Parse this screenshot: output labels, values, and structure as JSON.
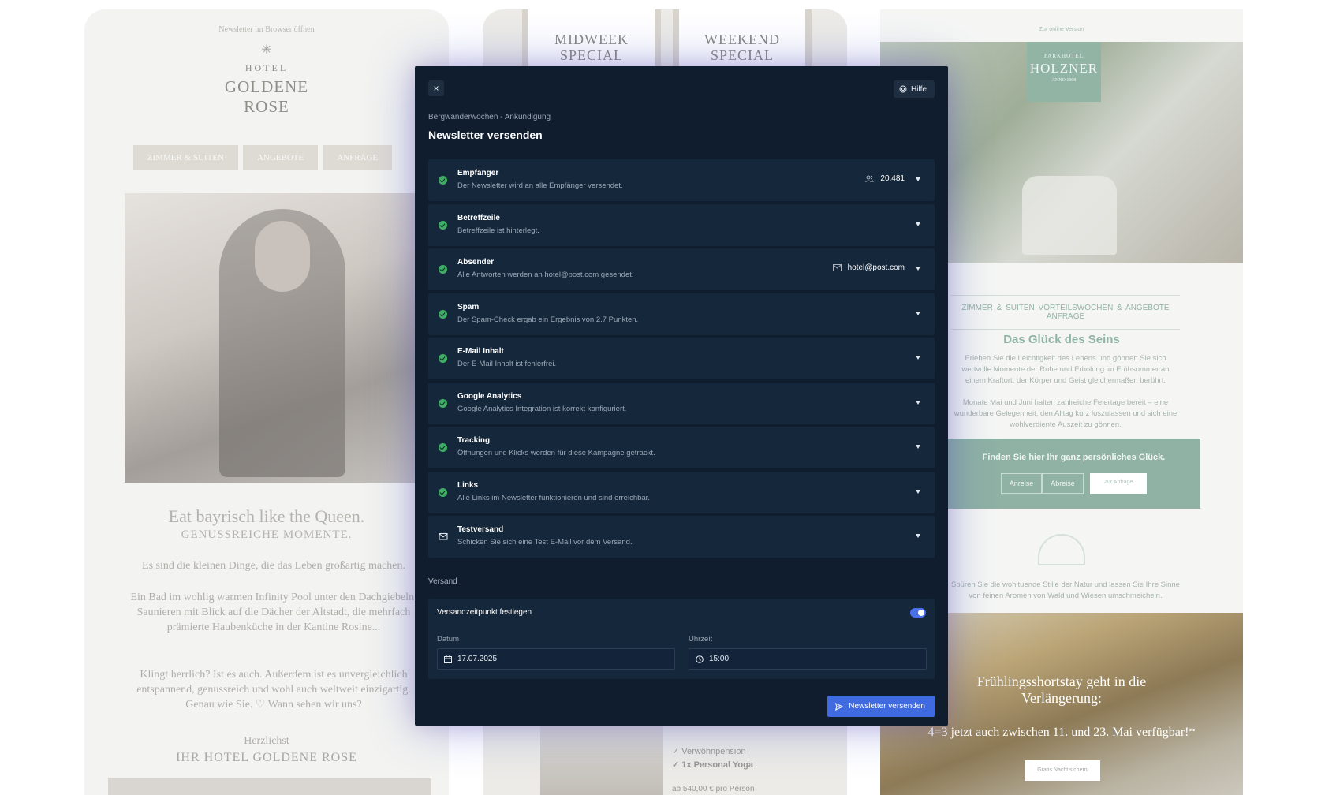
{
  "background": {
    "left": {
      "topline": "Newsletter im Browser öffnen",
      "hotel_word": "HOTEL",
      "hotel_name": "GOLDENE ROSE",
      "nav": [
        "ZIMMER & SUITEN",
        "ANGEBOTE",
        "ANFRAGE"
      ],
      "headline": "Eat bayrisch like the Queen.",
      "subheadline": "GENUSSREICHE MOMENTE.",
      "p1": "Es sind die kleinen Dinge, die das Leben großartig machen.",
      "p2": "Ein Bad im wohlig warmen Infinity Pool unter den Dachgiebeln, Saunieren mit Blick auf die Dächer der Altstadt, die mehrfach prämierte Haubenküche in der Kantine Rosine...",
      "p3": "Klingt herrlich? Ist es auch. Außerdem ist es unvergleichlich entspannend, genussreich und wohl auch weltweit einzigartig. Genau wie Sie. ♡ Wann sehen wir uns?",
      "closing": "Herzlichst",
      "signature": "IHR HOTEL GOLDENE ROSE"
    },
    "middle": {
      "card1": "MIDWEEK SPECIAL",
      "card2": "WEEKEND SPECIAL",
      "items": [
        "✓ Verwöhnpension",
        "✓ 1x Personal Yoga"
      ],
      "price": "ab 540,00 € pro Person"
    },
    "right": {
      "top_link": "Zur online Version",
      "logo_small": "PARKHOTEL",
      "logo_large": "HOLZNER",
      "logo_year": "ANNO 1908",
      "nav": "ZIMMER & SUITEN   VORTEILSWOCHEN & ANGEBOTE   ANFRAGE",
      "title": "Das Glück des Seins",
      "p1": "Erleben Sie die Leichtigkeit des Lebens und gönnen Sie sich wertvolle Momente der Ruhe und Erholung im Frühsommer an einem Kraftort, der Körper und Geist gleichermaßen berührt.",
      "p2": "Monate Mai und Juni halten zahlreiche Feiertage bereit – eine wunderbare Gelegenheit, den Alltag kurz loszulassen und sich eine wohlverdiente Auszeit zu gönnen.",
      "box_title": "Finden Sie hier Ihr ganz persönliches Glück.",
      "box_arrival": "Anreise",
      "box_departure": "Abreise",
      "box_button": "Zur Anfrage",
      "p3": "Spüren Sie die wohltuende Stille der Natur und lassen Sie Ihre Sinne von feinen Aromen von Wald und Wiesen umschmeicheln.",
      "promo_title": "Frühlingsshortstay geht in die Verlängerung:",
      "promo_sub": "4=3 jetzt auch zwischen 11. und 23. Mai verfügbar!*",
      "promo_button": "Gratis Nacht sichern"
    }
  },
  "dialog": {
    "close_label": "×",
    "help_label": "Hilfe",
    "breadcrumb": "Bergwanderwochen - Ankündigung",
    "title": "Newsletter versenden",
    "checks": [
      {
        "title": "Empfänger",
        "desc": "Der Newsletter wird an alle Empfänger versendet.",
        "meta": "20.481"
      },
      {
        "title": "Betreffzeile",
        "desc": "Betreffzeile ist hinterlegt."
      },
      {
        "title": "Absender",
        "desc": "Alle Antworten werden an hotel@post.com gesendet.",
        "meta": "hotel@post.com"
      },
      {
        "title": "Spam",
        "desc": "Der Spam-Check ergab ein Ergebnis von 2.7 Punkten."
      },
      {
        "title": "E-Mail Inhalt",
        "desc": "Der E-Mail Inhalt ist fehlerfrei."
      },
      {
        "title": "Google Analytics",
        "desc": "Google Analytics Integration ist korrekt konfiguriert."
      },
      {
        "title": "Tracking",
        "desc": "Öffnungen und Klicks werden für diese Kampagne getrackt."
      },
      {
        "title": "Links",
        "desc": "Alle Links im Newsletter funktionieren und sind erreichbar."
      },
      {
        "title": "Testversand",
        "desc": "Schicken Sie sich eine Test E-Mail vor dem Versand."
      }
    ],
    "section_label": "Versand",
    "schedule": {
      "label": "Versandzeitpunkt festlegen",
      "enabled": true,
      "date_label": "Datum",
      "date_value": "17.07.2025",
      "time_label": "Uhrzeit",
      "time_value": "15:00"
    },
    "send_label": "Newsletter versenden",
    "colors": {
      "success": "#3fae64",
      "accent": "#4a71e8",
      "panel": "#0f1d2f"
    }
  }
}
